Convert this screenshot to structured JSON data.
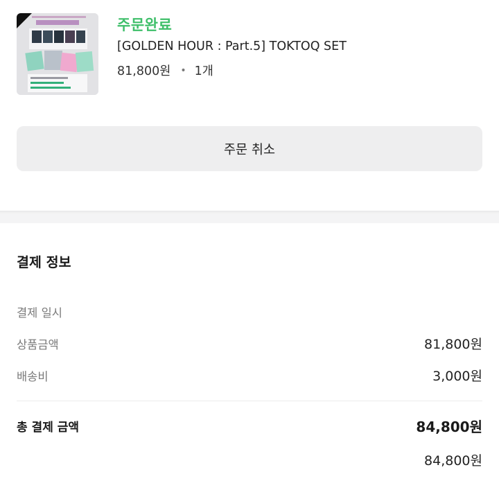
{
  "order": {
    "thumbnail_icon": "album-cover-image",
    "status": "주문완료",
    "status_color": "#3fbf6a",
    "product_name": "[GOLDEN HOUR : Part.5] TOKTOQ SET",
    "price": "81,800원",
    "separator": "•",
    "quantity": "1개"
  },
  "cancel_button": {
    "label": "주문 취소"
  },
  "payment": {
    "title": "결제 정보",
    "rows": [
      {
        "label": "결제 일시",
        "value": ""
      },
      {
        "label": "상품금액",
        "value": "81,800원"
      },
      {
        "label": "배송비",
        "value": "3,000원"
      }
    ],
    "total": {
      "label": "총 결제 금액",
      "value": "84,800원"
    },
    "method": {
      "label": "",
      "value": "84,800원"
    }
  }
}
